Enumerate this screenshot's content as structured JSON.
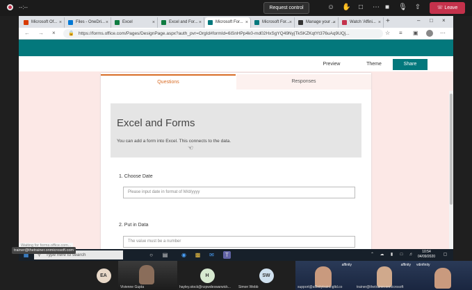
{
  "teams": {
    "timer": "--:--",
    "request_control": "Request control",
    "leave": "Leave",
    "icons": [
      "people-icon",
      "raise-hand-icon",
      "chat-icon",
      "more-icon",
      "camera-icon",
      "mic-icon",
      "share-icon",
      "call-icon"
    ]
  },
  "browser": {
    "tabs": [
      {
        "label": "Microsoft Of...",
        "color": "#d83b01"
      },
      {
        "label": "Files - OneDri...",
        "color": "#0078d4"
      },
      {
        "label": "Excel",
        "color": "#107c41"
      },
      {
        "label": "Excel and For...",
        "color": "#107c41"
      },
      {
        "label": "Microsoft For...",
        "color": "#03787c",
        "active": true
      },
      {
        "label": "Microsoft For...",
        "color": "#03787c"
      },
      {
        "label": "Manage your ...",
        "color": "#333333"
      },
      {
        "label": "Watch 'Affini...",
        "color": "#c4314b"
      }
    ],
    "new_tab": "+",
    "url": "https://forms.office.com/Pages/DesignPage.aspx?auth_pvr=OrgId#formId=6iSnHPp4k0-md02HxSgYQ49NyjTkSKZKqtYt376uAq9UQj..."
  },
  "form": {
    "toolbar": {
      "preview": "Preview",
      "theme": "Theme",
      "share": "Share"
    },
    "tabs": {
      "questions": "Questions",
      "responses": "Responses"
    },
    "title": "Excel and Forms",
    "description": "You can add a form into Excel. This connects to the data.",
    "questions": [
      {
        "label": "1. Choose Date",
        "placeholder": "Please input date in format of M/d/yyyy"
      },
      {
        "label": "2. Put in Data",
        "placeholder": "The value must be a number"
      }
    ],
    "status_url": "Waiting for forms.office.com..."
  },
  "taskbar": {
    "search": "Type here to search",
    "time": "10:54",
    "date": "04/09/2020"
  },
  "presenter_tip": "trainer@thetrainer.onmicrosoft.com",
  "participants": [
    {
      "initials": "EA",
      "name": "",
      "color": "#e8d8c8"
    },
    {
      "initials": "",
      "name": "Vivienne Gupta",
      "video": true
    },
    {
      "initials": "H",
      "name": "hayley.stock@nzpwdeswarwick...",
      "color": "#d6e8cf"
    },
    {
      "initials": "SW",
      "name": "Simon Webb",
      "color": "#cfe0ee"
    },
    {
      "initials": "",
      "name": "support@affinitytrainingltd.co",
      "video": true,
      "brand": "affinity"
    },
    {
      "initials": "",
      "name": "trainer@thetrainer.onmicrosoft",
      "video": true,
      "brand": "affinity"
    },
    {
      "initials": "",
      "name": "",
      "video": true,
      "brand": "vdinfinity"
    }
  ]
}
